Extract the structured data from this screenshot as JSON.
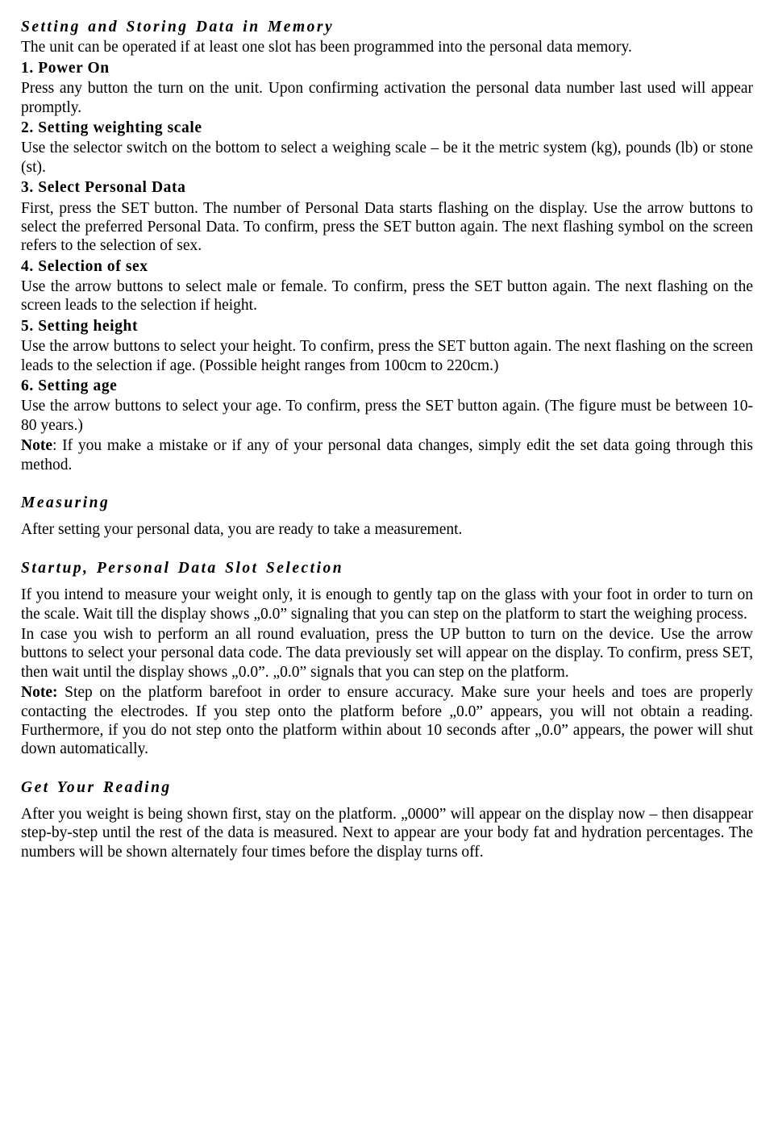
{
  "s1": {
    "title": "Setting and Storing Data in Memory",
    "intro": "The unit can be operated if at least one slot has been programmed into the personal data memory.",
    "h1": "1. Power On",
    "p1a": "Press any button the turn on the unit. Upon confirming activation the personal data number last used will appear promptly.",
    "h2": "2. Setting weighting scale",
    "p2a": "Use the selector switch on the bottom to select a weighing scale – be it the metric system (kg), pounds (lb) or stone (st).",
    "h3": "3. Select Personal Data",
    "p3a": "First, press the SET button. The number of Personal Data starts flashing on the display. Use the arrow buttons to select the preferred Personal Data. To confirm, press the SET button again. The next flashing symbol on the screen refers to the selection of sex.",
    "h4": "4. Selection of sex",
    "p4a": "Use the arrow buttons to select male or female. To confirm, press the SET button again. The next flashing on the screen leads to the selection if height.",
    "h5": "5. Setting height",
    "p5a": "Use the arrow buttons to select your height. To confirm, press the SET button again. The next flashing on the screen leads to the selection if age. (Possible height ranges from 100cm to 220cm.)",
    "h6": "6. Setting age",
    "p6a": "Use the arrow buttons to select your age. To confirm, press the SET button again. (The figure must be between 10-80 years.)",
    "noteLabel": "Note",
    "noteText": ": If you make a mistake or if any of your personal data changes, simply edit the set data going through this method."
  },
  "s2": {
    "title": "Measuring",
    "p1": "After setting your personal data, you are ready to take a measurement."
  },
  "s3": {
    "title": "Startup, Personal Data Slot Selection",
    "p1": "If you intend to measure your weight only, it is enough to gently tap on the glass with your foot in order to turn on the scale. Wait till the display shows „0.0” signaling that you can step on the platform to start the weighing process.",
    "p2": "In case you wish to perform an all round evaluation, press the UP button to turn on the device. Use the arrow buttons to select your personal data code. The data previously set will appear on the display. To confirm, press SET, then wait until the display shows „0.0”. „0.0” signals that you can step on the platform.",
    "noteLabel": "Note:",
    "noteText": " Step on the platform barefoot in order to ensure accuracy. Make sure your heels and toes are properly contacting the electrodes. If you step onto the platform before „0.0” appears, you will not obtain a reading. Furthermore, if you do not step onto the platform within about 10 seconds after „0.0” appears, the power will shut down automatically."
  },
  "s4": {
    "title": "Get Your Reading",
    "p1": "After you weight is being shown first, stay on the platform. „0000” will appear on the display now – then disappear step-by-step until the rest of the data is measured. Next to appear are your body fat and hydration percentages. The numbers will be shown alternately four times before the display turns off."
  }
}
